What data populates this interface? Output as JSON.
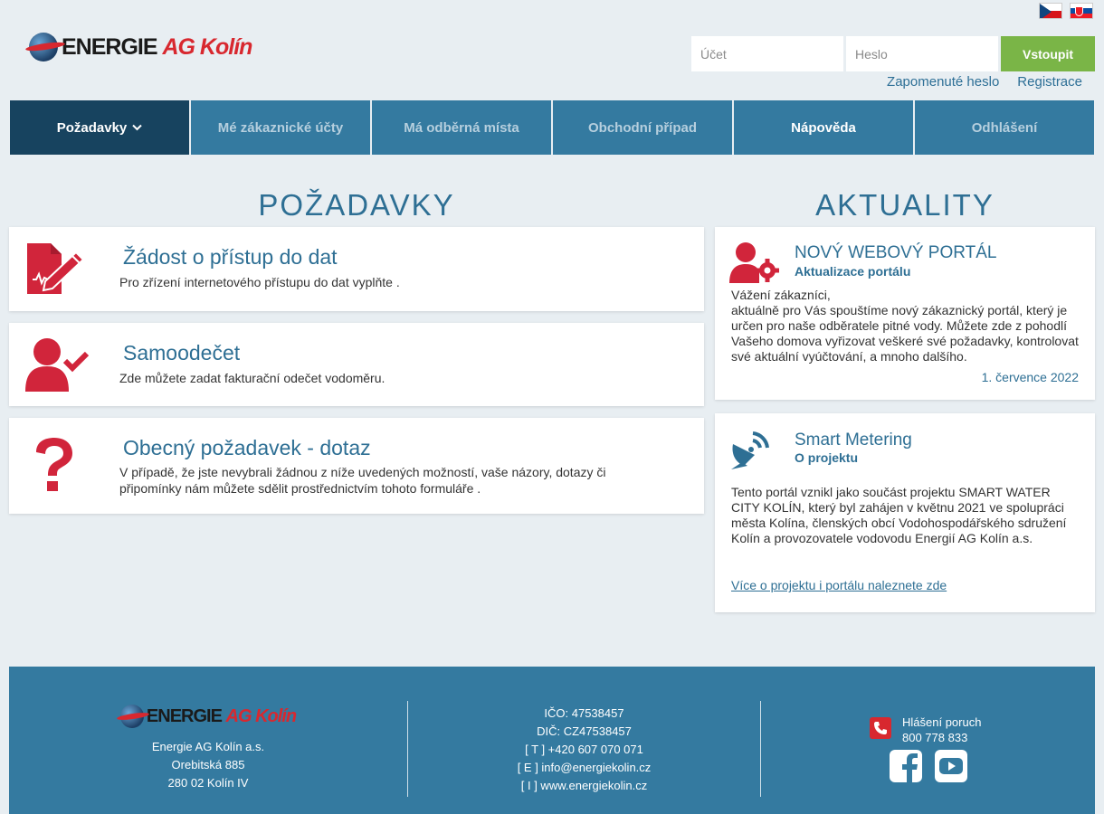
{
  "header": {
    "logo_main": "ENERGIE",
    "logo_accent": "AG Kolín",
    "account_placeholder": "Účet",
    "password_placeholder": "Heslo",
    "login_button": "Vstoupit",
    "forgot_password": "Zapomenuté heslo",
    "register": "Registrace"
  },
  "nav": [
    {
      "label": "Požadavky"
    },
    {
      "label": "Mé zákaznické účty"
    },
    {
      "label": "Má odběrná místa"
    },
    {
      "label": "Obchodní případ"
    },
    {
      "label": "Nápověda"
    },
    {
      "label": "Odhlášení"
    }
  ],
  "requests": {
    "title": "POŽADAVKY",
    "items": [
      {
        "title": "Žádost o přístup do dat",
        "desc": "Pro zřízení internetového přístupu do dat vyplňte ."
      },
      {
        "title": "Samoodečet",
        "desc": "Zde můžete zadat fakturační odečet vodoměru."
      },
      {
        "title": "Obecný požadavek - dotaz",
        "desc": "V případě, že jste nevybrali žádnou z níže uvedených možností, vaše názory, dotazy či připomínky nám můžete sdělit prostřednictvím tohoto formuláře ."
      }
    ]
  },
  "news": {
    "title": "AKTUALITY",
    "items": [
      {
        "title": "NOVÝ WEBOVÝ PORTÁL",
        "subtitle": "Aktualizace portálu",
        "body": "Vážení zákazníci,\naktuálně pro Vás spouštíme nový zákaznický portál, který je určen pro naše odběratele pitné vody. Můžete zde z pohodlí Vašeho domova vyřizovat veškeré své požadavky, kontrolovat své aktuální vyúčtování, a mnoho dalšího.",
        "date": "1. července 2022"
      },
      {
        "title": "Smart Metering",
        "subtitle": "O projektu",
        "body": "Tento portál vznikl jako součást projektu SMART WATER CITY KOLÍN, který byl zahájen v květnu 2021 ve spolupráci města Kolína, členských obcí Vodohospodářského sdružení Kolín a provozovatele vodovodu Energií AG Kolín a.s.",
        "link": "Více o projektu i portálu naleznete zde"
      }
    ]
  },
  "footer": {
    "company": "Energie AG Kolín a.s.",
    "street": "Orebitská 885",
    "city": "280 02 Kolín IV",
    "ico": "IČO: 47538457",
    "dic": "DIČ: CZ47538457",
    "phone": "[ T ] +420 607 070 071",
    "email": "[ E ] info@energiekolin.cz",
    "web": "[ I ] www.energiekolin.cz",
    "outage_label": "Hlášení poruch",
    "outage_phone": "800 778 833"
  },
  "colors": {
    "nav": "#347aa0",
    "nav_active": "#17435f",
    "accent_red": "#d8282f",
    "login_green": "#7ab547"
  }
}
